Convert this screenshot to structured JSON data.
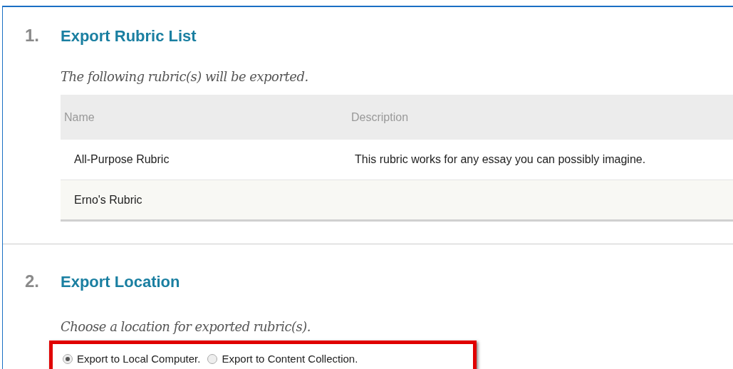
{
  "sections": [
    {
      "number": "1.",
      "title": "Export Rubric List",
      "instruction": "The following rubric(s) will be exported.",
      "table": {
        "columns": [
          "Name",
          "Description"
        ],
        "rows": [
          [
            "All-Purpose Rubric",
            "This rubric works for any essay you can possibly imagine."
          ],
          [
            "Erno's Rubric",
            ""
          ]
        ]
      }
    },
    {
      "number": "2.",
      "title": "Export Location",
      "instruction": "Choose a location for exported rubric(s).",
      "options": [
        {
          "label": "Export to Local Computer.",
          "selected": true
        },
        {
          "label": "Export to Content Collection.",
          "selected": false
        }
      ]
    }
  ]
}
